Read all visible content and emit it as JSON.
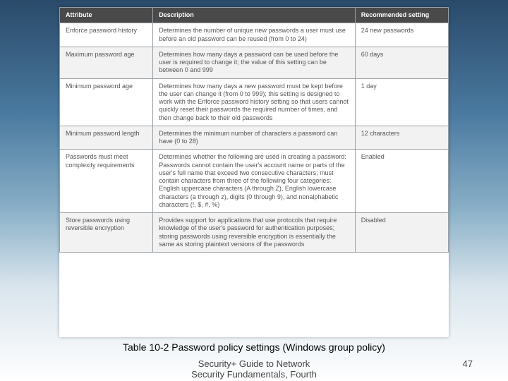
{
  "table": {
    "headers": [
      "Attribute",
      "Description",
      "Recommended setting"
    ],
    "rows": [
      {
        "attribute": "Enforce password history",
        "description": "Determines the number of unique new passwords a user must use before an old password can be reused (from 0 to 24)",
        "recommended": "24 new passwords"
      },
      {
        "attribute": "Maximum password age",
        "description": "Determines how many days a password can be used before the user is required to change it; the value of this setting can be between 0 and 999",
        "recommended": "60 days"
      },
      {
        "attribute": "Minimum password age",
        "description": "Determines how many days a new password must be kept before the user can change it (from 0 to 999); this setting is designed to work with the Enforce password history setting so that users cannot quickly reset their passwords the required number of times, and then change back to their old passwords",
        "recommended": "1 day"
      },
      {
        "attribute": "Minimum password length",
        "description": "Determines the minimum number of characters a password can have (0 to 28)",
        "recommended": "12 characters"
      },
      {
        "attribute": "Passwords must meet complexity requirements",
        "description": "Determines whether the following are used in creating a password: Passwords cannot contain the user's account name or parts of the user's full name that exceed two consecutive characters; must contain characters from three of the following four categories: English uppercase characters (A through Z), English lowercase characters (a through z), digits (0 through 9), and nonalphabetic characters (!, $, #, %)",
        "recommended": "Enabled"
      },
      {
        "attribute": "Store passwords using reversible encryption",
        "description": "Provides support for applications that use protocols that require knowledge of the user's password for authentication purposes; storing passwords using reversible encryption is essentially the same as storing plaintext versions of the passwords",
        "recommended": "Disabled"
      }
    ]
  },
  "caption": "Table 10-2 Password policy settings (Windows group policy)",
  "footer_line1": "Security+ Guide to Network",
  "footer_line2": "Security Fundamentals, Fourth",
  "page_number": "47"
}
